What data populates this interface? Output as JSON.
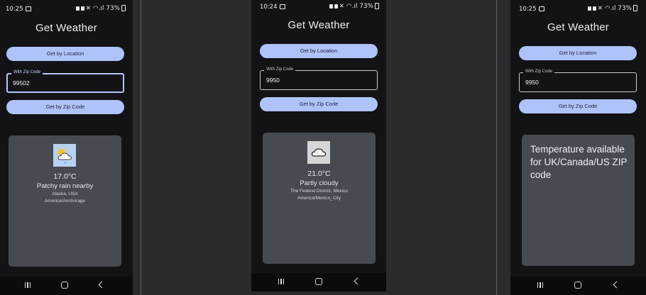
{
  "app": {
    "title": "Get Weather",
    "location_button": "Get by Location",
    "zip_button": "Get by Zip Code",
    "zip_label": "With Zip Code"
  },
  "screens": [
    {
      "status": {
        "time": "10:25",
        "battery": "73%"
      },
      "zip_value": "99502",
      "result": {
        "icon": "patchy-rain-icon",
        "temperature": "17.0°C",
        "condition": "Patchy rain nearby",
        "location": "Alaska, USA",
        "timezone": "America/Anchorage"
      }
    },
    {
      "status": {
        "time": "10:24",
        "battery": "73%"
      },
      "zip_value": "9950",
      "result": {
        "icon": "cloud-icon",
        "temperature": "21.0°C",
        "condition": "Partly cloudy",
        "location": "The Federal District, Mexico",
        "timezone": "America/Mexico_City"
      }
    },
    {
      "status": {
        "time": "10:25",
        "battery": "73%"
      },
      "zip_value": "9950",
      "message": "Temperature available for UK/Canada/US ZIP code"
    }
  ],
  "colors": {
    "background": "#2b2b2d",
    "screen": "#131316",
    "button": "#afc3fb",
    "card": "#474a51",
    "focus_border": "#b6c8ff"
  }
}
